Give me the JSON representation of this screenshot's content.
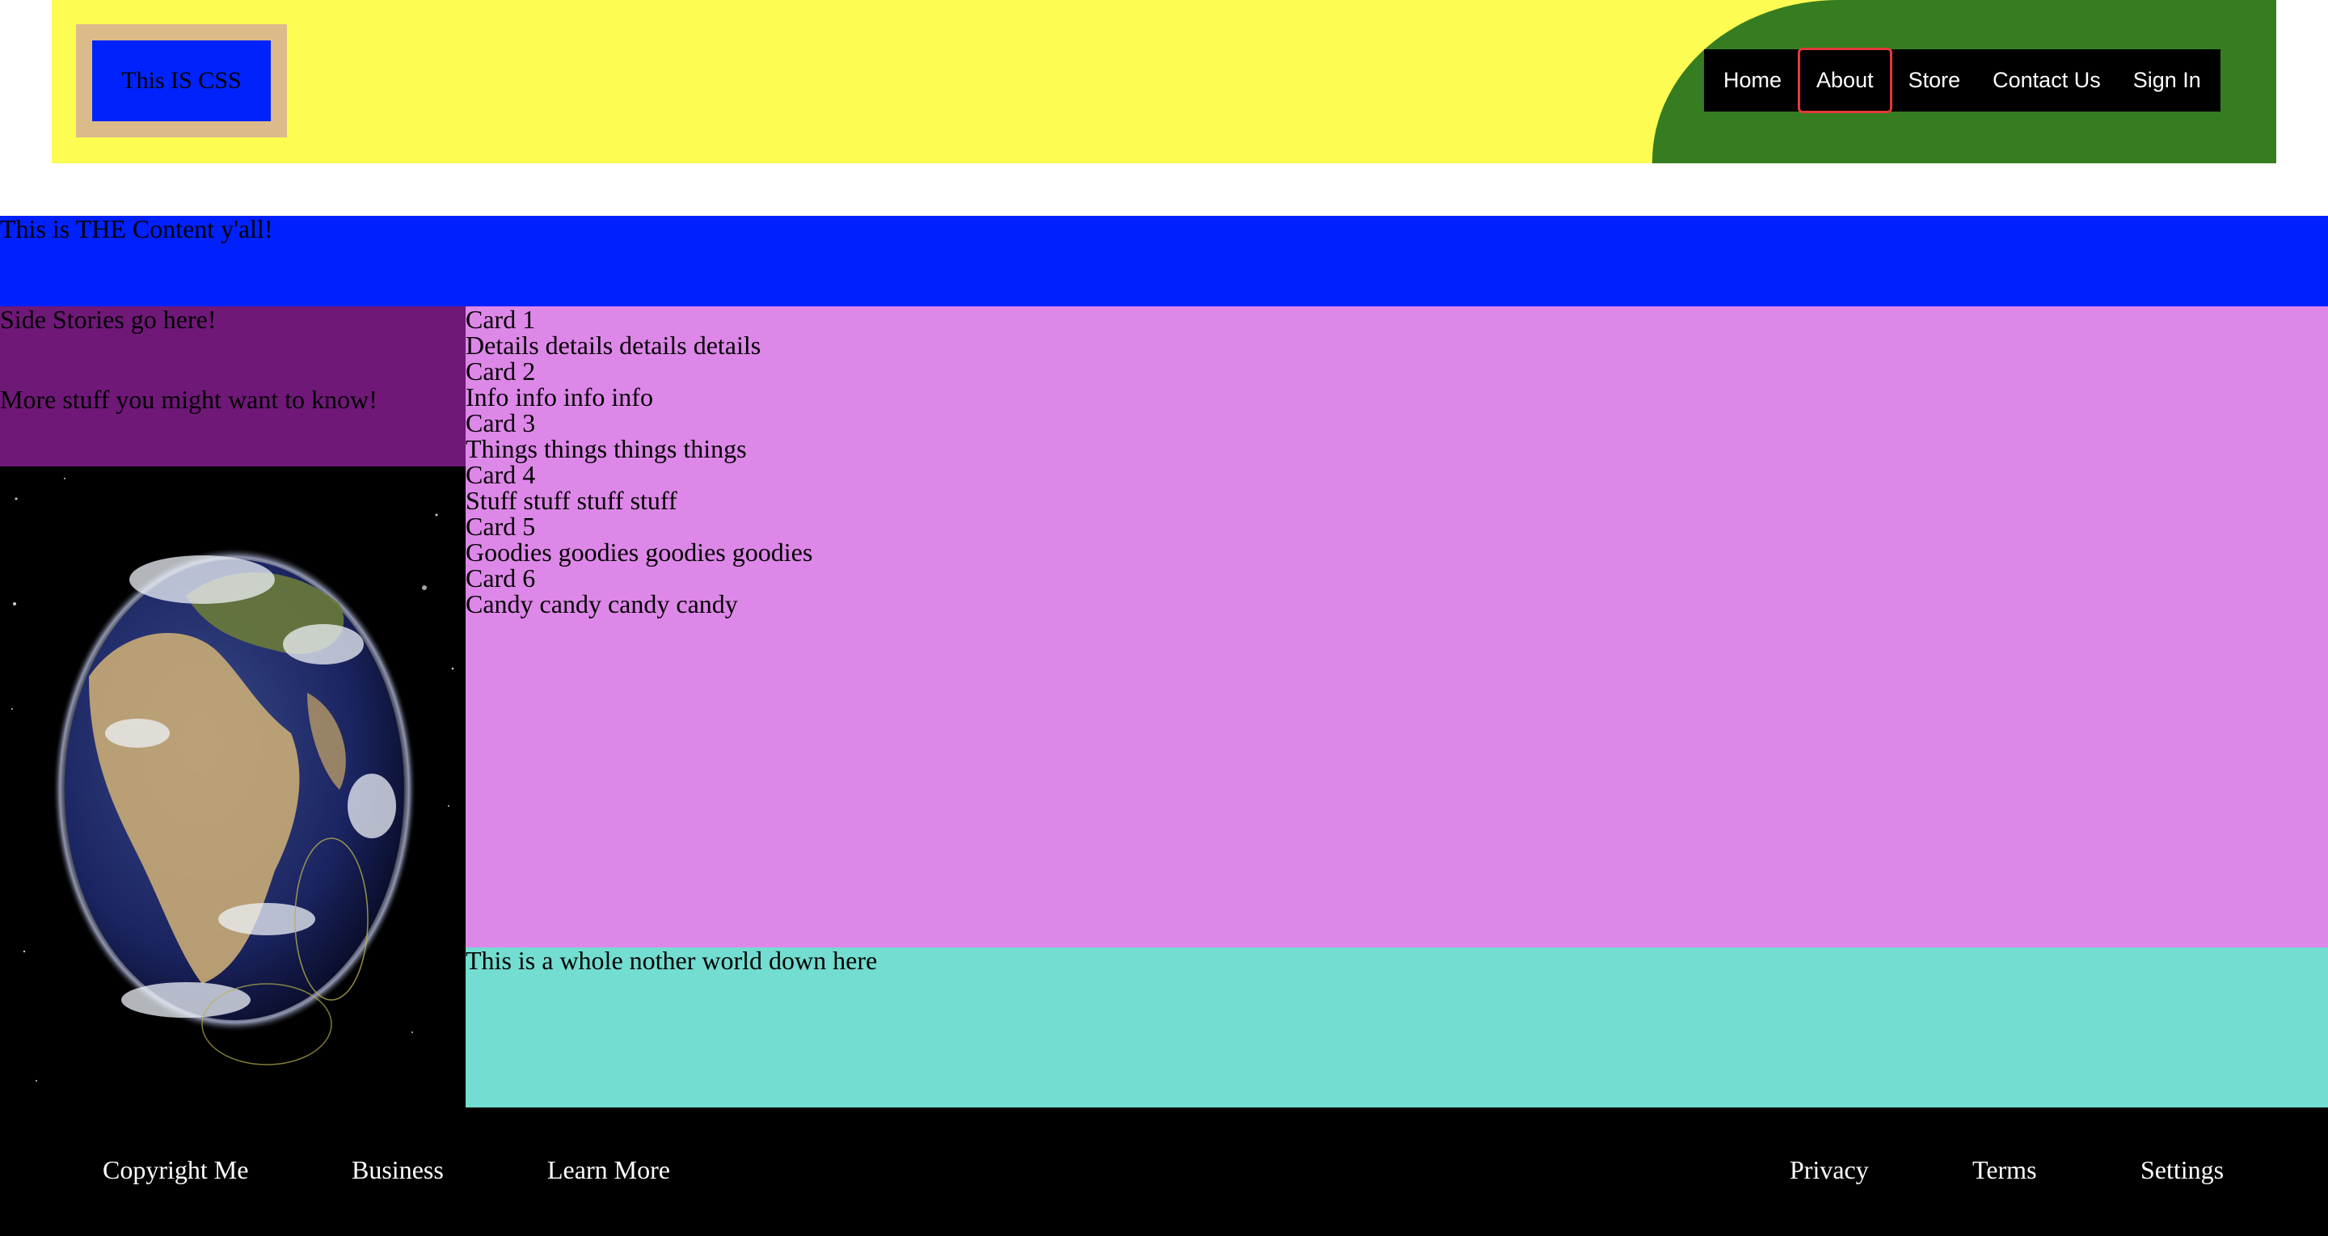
{
  "header": {
    "logo_text": "This IS CSS",
    "nav": [
      "Home",
      "About",
      "Store",
      "Contact Us",
      "Sign In"
    ],
    "active_nav": "About"
  },
  "content_banner": "This is THE Content y'all!",
  "sidebar": {
    "title": "Side Stories go here!",
    "more": "More stuff you might want to know!"
  },
  "cards": [
    {
      "title": "Card 1",
      "text": "Details details details details"
    },
    {
      "title": "Card 2",
      "text": "Info info info info"
    },
    {
      "title": "Card 3",
      "text": "Things things things things"
    },
    {
      "title": "Card 4",
      "text": "Stuff stuff stuff stuff"
    },
    {
      "title": "Card 5",
      "text": "Goodies goodies goodies goodies"
    },
    {
      "title": "Card 6",
      "text": "Candy candy candy candy"
    }
  ],
  "world_text": "This is a whole nother world down here",
  "footer": {
    "left": [
      "Copyright Me",
      "Business",
      "Learn More"
    ],
    "right": [
      "Privacy",
      "Terms",
      "Settings"
    ]
  },
  "colors": {
    "header_bg": "#fdfc52",
    "header_accent": "#367d22",
    "banner": "#0021fc",
    "sidebar": "#6f1878",
    "cards": "#dd87e8",
    "world": "#72ddd0",
    "footer": "#000000"
  }
}
